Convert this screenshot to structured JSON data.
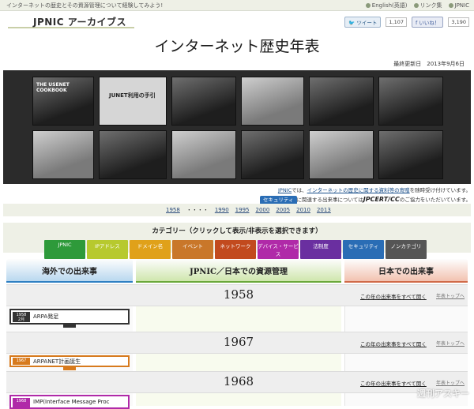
{
  "topbar": {
    "tagline": "インターネットの歴史とその資源管理について経験してみよう!",
    "english": "English(英語)",
    "links": "リンク集",
    "jpnic": "JPNIC"
  },
  "header": {
    "logo": "JPNIC アーカイブス"
  },
  "social": {
    "tweet": "ツイート",
    "tweet_count": "1,107",
    "like": "いいね！",
    "like_count": "3,190"
  },
  "page_title": "インターネット歴史年表",
  "updated": "最終更新日　2013年9月6日",
  "photos": [
    {
      "caption": "THE USENET COOKBOOK",
      "style": "dark"
    },
    {
      "caption": "JUNET利用の手引",
      "style": "doc"
    },
    {
      "caption": "",
      "style": "dark"
    },
    {
      "caption": "",
      "style": "light"
    },
    {
      "caption": "",
      "style": "dark"
    },
    {
      "caption": "",
      "style": "dark"
    },
    {
      "caption": "",
      "style": "light"
    },
    {
      "caption": "",
      "style": "dark"
    },
    {
      "caption": "",
      "style": "light"
    },
    {
      "caption": "",
      "style": "dark"
    },
    {
      "caption": "",
      "style": "light"
    },
    {
      "caption": "",
      "style": "dark"
    },
    {
      "caption": "",
      "style": "dark"
    },
    {
      "caption": "",
      "style": "light"
    }
  ],
  "notice": {
    "line1_prefix": "JPNIC",
    "line1_mid": "では、",
    "line1_link": "インターネットの歴史に関する資料等の寄贈",
    "line1_suffix": "を随時受け付けています。",
    "badge": "セキュリティ",
    "line2_mid": "に関連する出来事については",
    "jpcert": "JPCERT/CC",
    "line2_suffix": "のご協力をいただいています。"
  },
  "yearnav": {
    "items": [
      "1958",
      "・・・・",
      "1990",
      "1995",
      "2000",
      "2005",
      "2010",
      "2013"
    ]
  },
  "categories": {
    "title": "カテゴリー（クリックして表示/非表示を選択できます）",
    "items": [
      {
        "label": "JPNIC",
        "color": "#2e9a3a"
      },
      {
        "label": "IPアドレス",
        "color": "#b7c92e"
      },
      {
        "label": "ドメイン名",
        "color": "#e0a11a"
      },
      {
        "label": "イベント",
        "color": "#c9772a"
      },
      {
        "label": "ネットワーク",
        "color": "#c24a1e"
      },
      {
        "label": "デバイス・サービス",
        "color": "#b02aa8"
      },
      {
        "label": "法制度",
        "color": "#6a2fa0"
      },
      {
        "label": "セキュリティ",
        "color": "#2a6db5"
      },
      {
        "label": "ノンカテゴリ",
        "color": "#555555"
      }
    ]
  },
  "columns": {
    "overseas": "海外での出来事",
    "jpnic": "JPNIC／日本での資源管理",
    "japan": "日本での出来事"
  },
  "years": [
    {
      "year": "1958",
      "all_link": "この年の出来事をすべて開く",
      "to_top": "年表トップへ"
    },
    {
      "year": "1967",
      "all_link": "この年の出来事をすべて開く",
      "to_top": "年表トップへ"
    },
    {
      "year": "1968",
      "all_link": "この年の出来事をすべて開く",
      "to_top": "年表トップへ"
    }
  ],
  "events": [
    {
      "date_year": "1958",
      "date_month": "2月",
      "title": "ARPA発足"
    },
    {
      "date_year": "1967",
      "date_month": "",
      "title": "ARPANET計画誕生"
    },
    {
      "date_year": "1968",
      "date_month": "",
      "title": "IMP(Interface Message Proc"
    }
  ],
  "watermark": "週刊アスキー"
}
